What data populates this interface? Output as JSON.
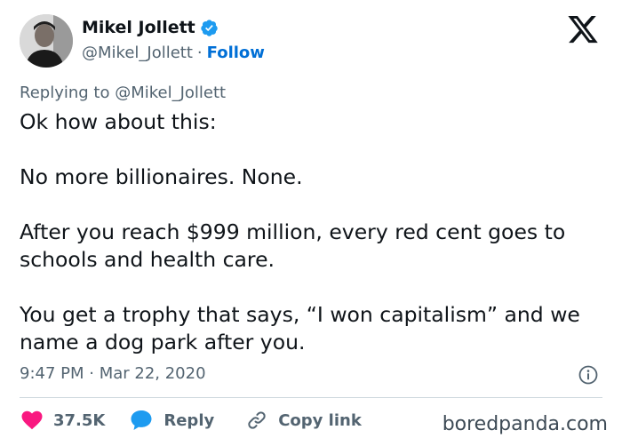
{
  "author": {
    "display_name": "Mikel Jollett",
    "handle": "@Mikel_Jollett",
    "separator": "·",
    "follow_label": "Follow"
  },
  "tweet": {
    "replying_to": "Replying to @Mikel_Jollett",
    "lines": [
      "Ok how about this:",
      "No more billionaires. None.",
      "After you reach $999 million, every red cent goes to schools and health care.",
      "You get a trophy that says, “I won capitalism” and we name a dog park after you."
    ],
    "timestamp": "9:47 PM · Mar 22, 2020"
  },
  "actions": {
    "like_count": "37.5K",
    "reply_label": "Reply",
    "copy_label": "Copy link"
  },
  "watermark": "boredpanda.com",
  "colors": {
    "accent": "#1d9bf0",
    "follow": "#006fd6",
    "like": "#f91880",
    "muted": "#536471",
    "text": "#0f1419"
  },
  "icons": [
    "verified-badge-icon",
    "x-logo-icon",
    "info-icon",
    "heart-icon",
    "reply-bubble-icon",
    "link-icon"
  ]
}
